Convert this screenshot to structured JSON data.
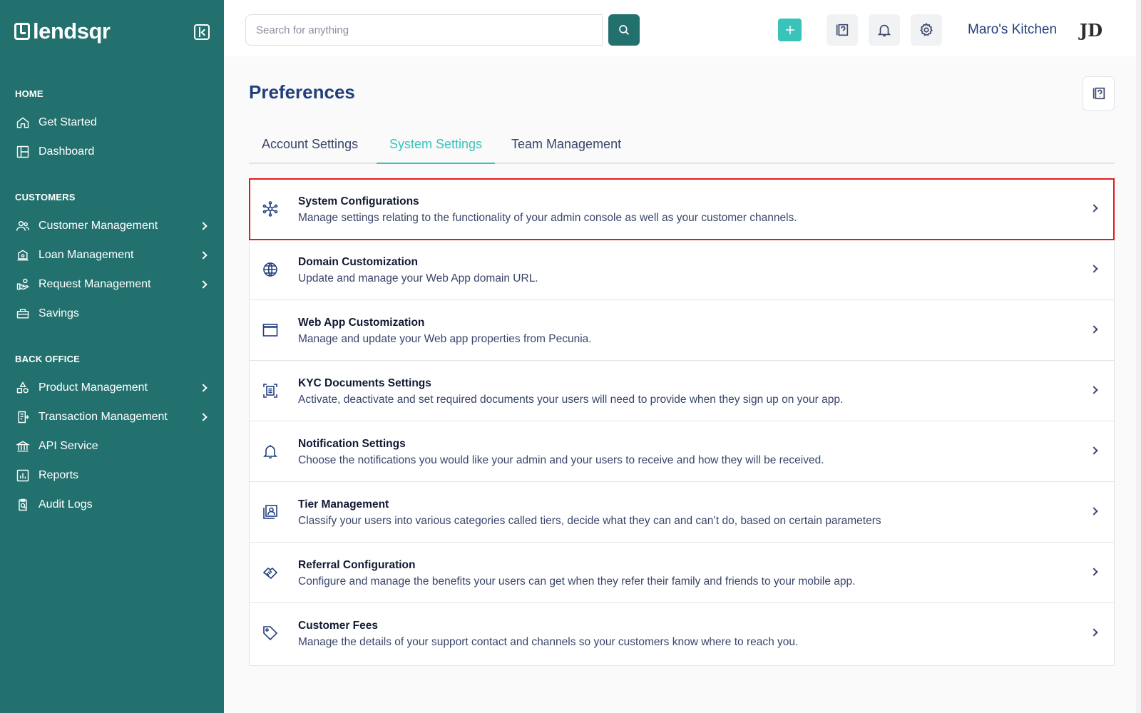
{
  "brand": {
    "logo_text": "lendsqr"
  },
  "sidebar": {
    "sections": [
      {
        "title": "HOME",
        "items": [
          {
            "label": "Get Started",
            "icon": "home-icon",
            "has_chevron": false
          },
          {
            "label": "Dashboard",
            "icon": "dashboard-icon",
            "has_chevron": false
          }
        ]
      },
      {
        "title": "CUSTOMERS",
        "items": [
          {
            "label": "Customer Management",
            "icon": "users-icon",
            "has_chevron": true
          },
          {
            "label": "Loan Management",
            "icon": "loan-icon",
            "has_chevron": true
          },
          {
            "label": "Request Management",
            "icon": "request-icon",
            "has_chevron": true
          },
          {
            "label": "Savings",
            "icon": "savings-icon",
            "has_chevron": false
          }
        ]
      },
      {
        "title": "BACK OFFICE",
        "items": [
          {
            "label": "Product Management",
            "icon": "product-icon",
            "has_chevron": true
          },
          {
            "label": "Transaction Management",
            "icon": "transaction-icon",
            "has_chevron": true
          },
          {
            "label": "API Service",
            "icon": "bank-icon",
            "has_chevron": false
          },
          {
            "label": "Reports",
            "icon": "reports-icon",
            "has_chevron": false
          },
          {
            "label": "Audit Logs",
            "icon": "audit-icon",
            "has_chevron": false
          }
        ]
      }
    ]
  },
  "header": {
    "search": {
      "placeholder": "Search for anything",
      "value": ""
    },
    "org_name": "Maro's Kitchen",
    "avatar_initials": "JD"
  },
  "main": {
    "page_title": "Preferences",
    "tabs": [
      {
        "label": "Account Settings",
        "active": false
      },
      {
        "label": "System Settings",
        "active": true
      },
      {
        "label": "Team Management",
        "active": false
      }
    ],
    "settings": [
      {
        "title": "System Configurations",
        "description": "Manage settings relating to the functionality of your admin console as well as your customer channels.",
        "icon": "network-icon",
        "highlighted": true
      },
      {
        "title": "Domain Customization",
        "description": "Update and manage your Web App domain URL.",
        "icon": "globe-icon",
        "highlighted": false
      },
      {
        "title": "Web App Customization",
        "description": "Manage and update your Web app properties from Pecunia.",
        "icon": "browser-window-icon",
        "highlighted": false
      },
      {
        "title": "KYC Documents Settings",
        "description": "Activate, deactivate and set required documents your users will need to provide when they sign up on your app.",
        "icon": "document-scan-icon",
        "highlighted": false
      },
      {
        "title": "Notification Settings",
        "description": "Choose the notifications you would like your admin and your users to receive and how they will be received.",
        "icon": "bell-icon",
        "highlighted": false
      },
      {
        "title": "Tier Management",
        "description": "Classify your users into various categories called tiers, decide what they can and can’t do, based on certain parameters",
        "icon": "user-profile-icon",
        "highlighted": false
      },
      {
        "title": "Referral Configuration",
        "description": "Configure and manage the benefits your users can get when they refer their family and friends to your mobile app.",
        "icon": "handshake-icon",
        "highlighted": false
      },
      {
        "title": "Customer Fees",
        "description": "Manage the details of your support contact and channels so your customers know where to reach you.",
        "icon": "tag-icon",
        "highlighted": false
      }
    ]
  },
  "colors": {
    "sidebar_bg": "#23716f",
    "accent": "#39c3bb",
    "primary_text": "#213f7d",
    "highlight_border": "#e5181b"
  }
}
